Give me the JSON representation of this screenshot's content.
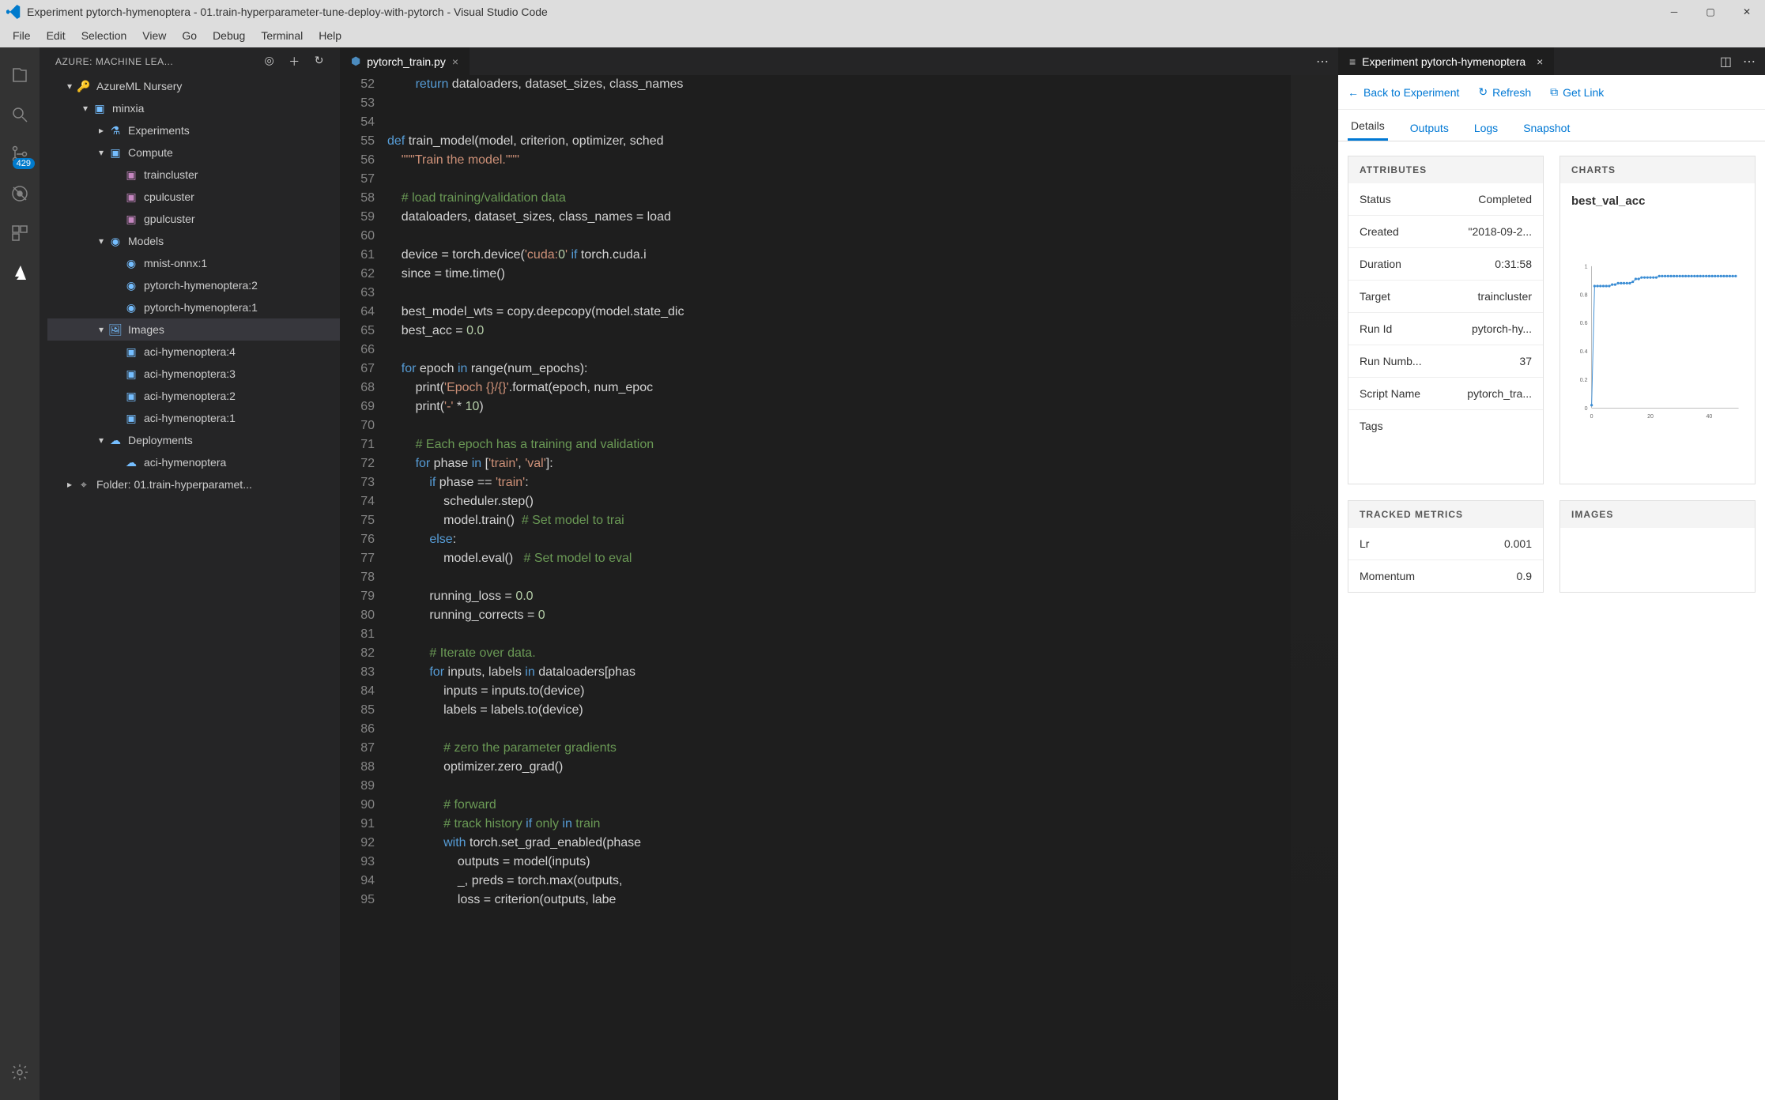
{
  "window_title": "Experiment pytorch-hymenoptera - 01.train-hyperparameter-tune-deploy-with-pytorch - Visual Studio Code",
  "menubar": [
    "File",
    "Edit",
    "Selection",
    "View",
    "Go",
    "Debug",
    "Terminal",
    "Help"
  ],
  "activitybar": {
    "badge": "429"
  },
  "sidebar": {
    "title": "AZURE: MACHINE LEA...",
    "tree": [
      {
        "indent": 1,
        "arrow": "▾",
        "icon": "🔑",
        "label": "AzureML Nursery",
        "color": "#dcdcaa"
      },
      {
        "indent": 2,
        "arrow": "▾",
        "icon": "▣",
        "label": "minxia",
        "color": "#75beff"
      },
      {
        "indent": 3,
        "arrow": "▸",
        "icon": "⚗",
        "label": "Experiments",
        "color": "#75beff"
      },
      {
        "indent": 3,
        "arrow": "▾",
        "icon": "▣",
        "label": "Compute",
        "color": "#75beff"
      },
      {
        "indent": 4,
        "arrow": "",
        "icon": "▣",
        "label": "traincluster",
        "color": "#c586c0"
      },
      {
        "indent": 4,
        "arrow": "",
        "icon": "▣",
        "label": "cpulcuster",
        "color": "#c586c0"
      },
      {
        "indent": 4,
        "arrow": "",
        "icon": "▣",
        "label": "gpulcuster",
        "color": "#c586c0"
      },
      {
        "indent": 3,
        "arrow": "▾",
        "icon": "◉",
        "label": "Models",
        "color": "#75beff"
      },
      {
        "indent": 4,
        "arrow": "",
        "icon": "◉",
        "label": "mnist-onnx:1",
        "color": "#75beff"
      },
      {
        "indent": 4,
        "arrow": "",
        "icon": "◉",
        "label": "pytorch-hymenoptera:2",
        "color": "#75beff"
      },
      {
        "indent": 4,
        "arrow": "",
        "icon": "◉",
        "label": "pytorch-hymenoptera:1",
        "color": "#75beff"
      },
      {
        "indent": 3,
        "arrow": "▾",
        "icon": "🖼",
        "label": "Images",
        "color": "#75beff",
        "selected": true
      },
      {
        "indent": 4,
        "arrow": "",
        "icon": "▣",
        "label": "aci-hymenoptera:4",
        "color": "#75beff"
      },
      {
        "indent": 4,
        "arrow": "",
        "icon": "▣",
        "label": "aci-hymenoptera:3",
        "color": "#75beff"
      },
      {
        "indent": 4,
        "arrow": "",
        "icon": "▣",
        "label": "aci-hymenoptera:2",
        "color": "#75beff"
      },
      {
        "indent": 4,
        "arrow": "",
        "icon": "▣",
        "label": "aci-hymenoptera:1",
        "color": "#75beff"
      },
      {
        "indent": 3,
        "arrow": "▾",
        "icon": "☁",
        "label": "Deployments",
        "color": "#75beff"
      },
      {
        "indent": 4,
        "arrow": "",
        "icon": "☁",
        "label": "aci-hymenoptera",
        "color": "#75beff"
      },
      {
        "indent": 1,
        "arrow": "▸",
        "icon": "⌖",
        "label": "Folder: 01.train-hyperparamet...",
        "color": "#ccc"
      }
    ]
  },
  "editor": {
    "tab_label": "pytorch_train.py",
    "first_line": 52,
    "lines": [
      "        return dataloaders, dataset_sizes, class_names",
      "",
      "",
      "def train_model(model, criterion, optimizer, sched",
      "    \"\"\"Train the model.\"\"\"",
      "",
      "    # load training/validation data",
      "    dataloaders, dataset_sizes, class_names = load",
      "",
      "    device = torch.device('cuda:0' if torch.cuda.i",
      "    since = time.time()",
      "",
      "    best_model_wts = copy.deepcopy(model.state_dic",
      "    best_acc = 0.0",
      "",
      "    for epoch in range(num_epochs):",
      "        print('Epoch {}/{}'.format(epoch, num_epoc",
      "        print('-' * 10)",
      "",
      "        # Each epoch has a training and validation",
      "        for phase in ['train', 'val']:",
      "            if phase == 'train':",
      "                scheduler.step()",
      "                model.train()  # Set model to trai",
      "            else:",
      "                model.eval()   # Set model to eval",
      "",
      "            running_loss = 0.0",
      "            running_corrects = 0",
      "",
      "            # Iterate over data.",
      "            for inputs, labels in dataloaders[phas",
      "                inputs = inputs.to(device)",
      "                labels = labels.to(device)",
      "",
      "                # zero the parameter gradients",
      "                optimizer.zero_grad()",
      "",
      "                # forward",
      "                # track history if only in train",
      "                with torch.set_grad_enabled(phase ",
      "                    outputs = model(inputs)",
      "                    _, preds = torch.max(outputs, ",
      "                    loss = criterion(outputs, labe"
    ]
  },
  "panel": {
    "tab_label": "Experiment pytorch-hymenoptera",
    "cmd_back": "Back to Experiment",
    "cmd_refresh": "Refresh",
    "cmd_link": "Get Link",
    "tabs": [
      "Details",
      "Outputs",
      "Logs",
      "Snapshot"
    ],
    "active_tab": 0,
    "attributes_title": "ATTRIBUTES",
    "attributes": [
      {
        "k": "Status",
        "v": "Completed"
      },
      {
        "k": "Created",
        "v": "\"2018-09-2..."
      },
      {
        "k": "Duration",
        "v": "0:31:58"
      },
      {
        "k": "Target",
        "v": "traincluster"
      },
      {
        "k": "Run Id",
        "v": "pytorch-hy..."
      },
      {
        "k": "Run Numb...",
        "v": "37"
      },
      {
        "k": "Script Name",
        "v": "pytorch_tra..."
      },
      {
        "k": "Tags",
        "v": ""
      }
    ],
    "charts_title": "CHARTS",
    "metrics_title": "TRACKED METRICS",
    "metrics": [
      {
        "k": "Lr",
        "v": "0.001"
      },
      {
        "k": "Momentum",
        "v": "0.9"
      }
    ],
    "images_title": "IMAGES"
  },
  "chart_data": {
    "type": "line",
    "title": "best_val_acc",
    "xlabel": "",
    "ylabel": "",
    "xlim": [
      0,
      50
    ],
    "ylim": [
      0,
      1
    ],
    "x_ticks": [
      0,
      20,
      40
    ],
    "y_ticks": [
      0,
      0.2,
      0.4,
      0.6,
      0.8,
      1
    ],
    "x": [
      0,
      1,
      2,
      3,
      4,
      5,
      6,
      7,
      8,
      9,
      10,
      11,
      12,
      13,
      14,
      15,
      16,
      17,
      18,
      19,
      20,
      21,
      22,
      23,
      24,
      25,
      26,
      27,
      28,
      29,
      30,
      31,
      32,
      33,
      34,
      35,
      36,
      37,
      38,
      39,
      40,
      41,
      42,
      43,
      44,
      45,
      46,
      47,
      48,
      49
    ],
    "y": [
      0.02,
      0.86,
      0.86,
      0.86,
      0.86,
      0.86,
      0.86,
      0.87,
      0.87,
      0.88,
      0.88,
      0.88,
      0.88,
      0.88,
      0.89,
      0.91,
      0.91,
      0.92,
      0.92,
      0.92,
      0.92,
      0.92,
      0.92,
      0.93,
      0.93,
      0.93,
      0.93,
      0.93,
      0.93,
      0.93,
      0.93,
      0.93,
      0.93,
      0.93,
      0.93,
      0.93,
      0.93,
      0.93,
      0.93,
      0.93,
      0.93,
      0.93,
      0.93,
      0.93,
      0.93,
      0.93,
      0.93,
      0.93,
      0.93,
      0.93
    ]
  }
}
